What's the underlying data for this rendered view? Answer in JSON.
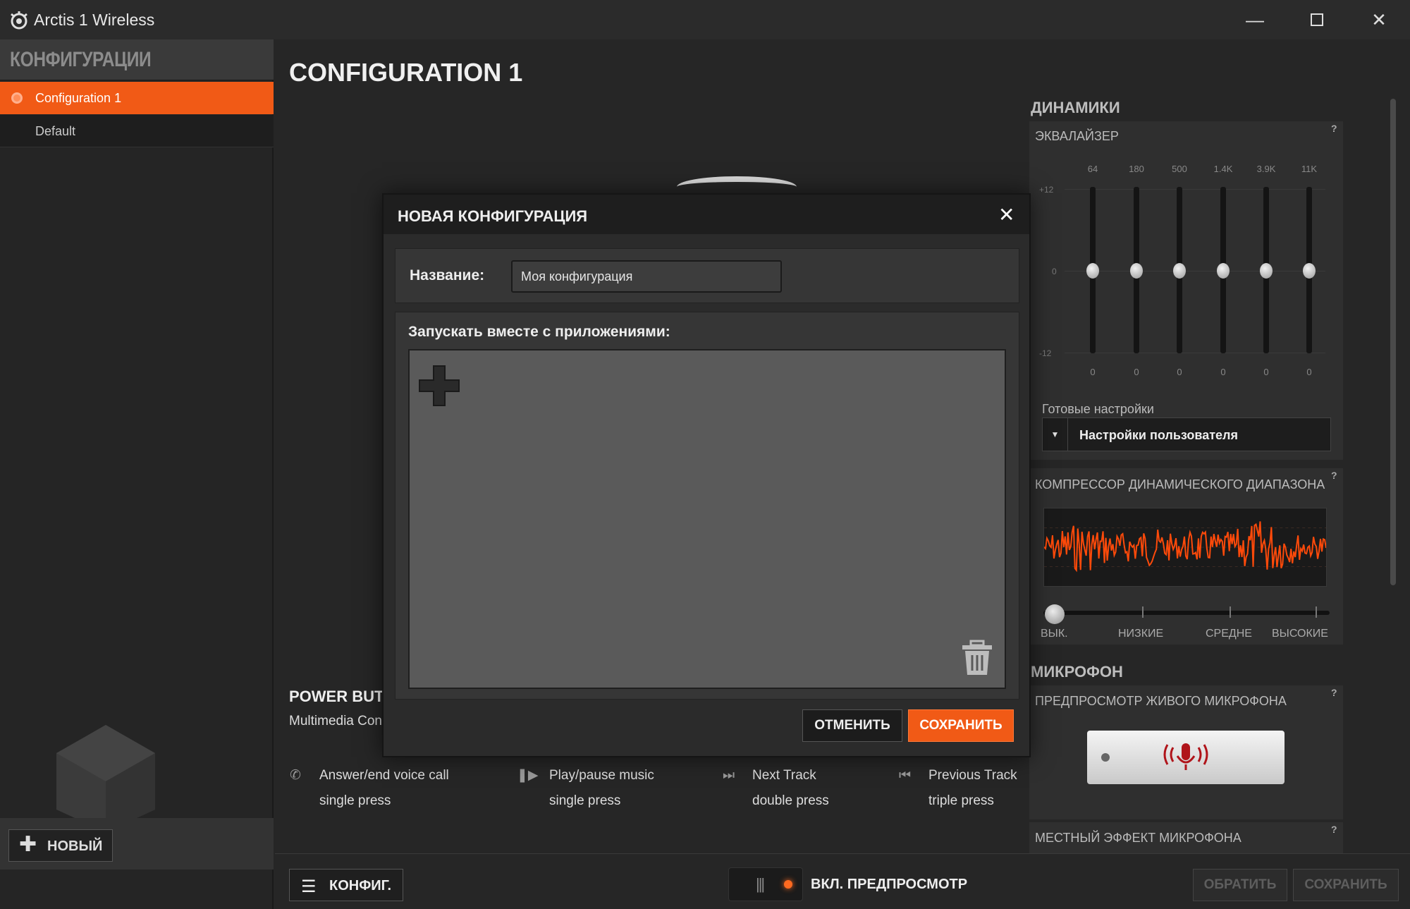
{
  "window": {
    "title": "Arctis 1 Wireless"
  },
  "sidebar": {
    "header": "КОНФИГУРАЦИИ",
    "items": [
      {
        "label": "Configuration 1",
        "active": true
      },
      {
        "label": "Default",
        "active": false
      }
    ],
    "new_button": "НОВЫЙ"
  },
  "main": {
    "title": "CONFIGURATION 1",
    "power_title": "POWER BUT",
    "power_sub": "Multimedia Con",
    "actions": [
      {
        "icon": "phone-icon",
        "label": "Answer/end voice call",
        "press": "single press"
      },
      {
        "icon": "play-pause-icon",
        "label": "Play/pause music",
        "press": "single press"
      },
      {
        "icon": "next-track-icon",
        "label": "Next Track",
        "press": "double press"
      },
      {
        "icon": "previous-track-icon",
        "label": "Previous Track",
        "press": "triple press"
      }
    ]
  },
  "bottom": {
    "config_button": "КОНФИГ.",
    "preview_label": "ВКЛ. ПРЕДПРОСМОТР",
    "revert_button": "ОБРАТИТЬ",
    "save_button": "СОХРАНИТЬ"
  },
  "speakers": {
    "title": "ДИНАМИКИ",
    "eq_title": "ЭКВАЛАЙЗЕР",
    "eq_axis": [
      "+12",
      "0",
      "-12"
    ],
    "bands": [
      {
        "freq": "64",
        "value": "0"
      },
      {
        "freq": "180",
        "value": "0"
      },
      {
        "freq": "500",
        "value": "0"
      },
      {
        "freq": "1.4K",
        "value": "0"
      },
      {
        "freq": "3.9K",
        "value": "0"
      },
      {
        "freq": "11K",
        "value": "0"
      }
    ],
    "presets_label": "Готовые настройки",
    "presets_value": "Настройки пользователя",
    "compressor_title": "КОМПРЕССОР ДИНАМИЧЕСКОГО ДИАПАЗОНА",
    "compressor_levels": [
      "ВЫК.",
      "НИЗКИЕ",
      "СРЕДНЕ",
      "ВЫСОКИЕ"
    ],
    "compressor_level": 0
  },
  "microphone": {
    "title": "МИКРОФОН",
    "live_preview_title": "ПРЕДПРОСМОТР ЖИВОГО МИКРОФОНА",
    "sidetone_title": "МЕСТНЫЙ ЭФФЕКТ МИКРОФОНА"
  },
  "dialog": {
    "title": "НОВАЯ КОНФИГУРАЦИЯ",
    "name_label": "Название:",
    "name_value": "Моя конфигурация",
    "apps_label": "Запускать вместе с приложениями:",
    "cancel_button": "ОТМЕНИТЬ",
    "save_button": "СОХРАНИТЬ"
  },
  "colors": {
    "accent": "#f15a16",
    "background": "#262626",
    "waveform": "#ff4a0a"
  }
}
